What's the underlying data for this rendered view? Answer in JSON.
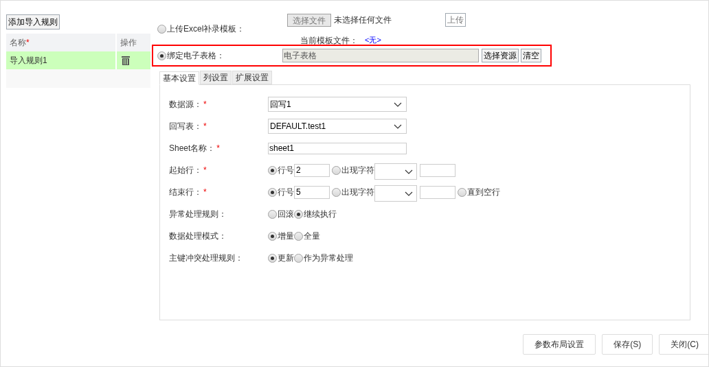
{
  "rules_panel": {
    "add_button": "添加导入规则",
    "columns": [
      {
        "label": "名称",
        "required_mark": "*"
      },
      {
        "label": "操作"
      }
    ],
    "rows": [
      {
        "name": "导入规则1",
        "selected": true
      }
    ]
  },
  "upload": {
    "label": "上传Excel补录模板：",
    "selected": false,
    "file_button": "选择文件",
    "file_status": "未选择任何文件",
    "upload_button": "上传",
    "current_label": "当前模板文件：",
    "current_value": "<无>"
  },
  "bind": {
    "label": "绑定电子表格：",
    "selected": true,
    "highlighted": true,
    "value": "电子表格",
    "choose_button": "选择资源",
    "clear_button": "清空"
  },
  "tabs": [
    {
      "label": "基本设置",
      "selected": true
    },
    {
      "label": "列设置",
      "selected": false
    },
    {
      "label": "扩展设置",
      "selected": false
    }
  ],
  "fields": [
    {
      "label": "数据源：",
      "required_mark": "*",
      "kind": "select",
      "value": "回写1"
    },
    {
      "label": "回写表：",
      "required_mark": "*",
      "kind": "select",
      "value": "DEFAULT.test1"
    },
    {
      "label": "Sheet名称：",
      "required_mark": "*",
      "kind": "text",
      "value": "sheet1"
    },
    {
      "label": "起始行：",
      "required_mark": "*",
      "kind": "options",
      "items": [
        {
          "kind": "radio",
          "label": "行号",
          "selected": true
        },
        {
          "kind": "input",
          "value": "2"
        },
        {
          "kind": "radio",
          "label": "出现字符",
          "selected": false
        },
        {
          "kind": "select"
        },
        {
          "kind": "input"
        }
      ]
    },
    {
      "label": "结束行：",
      "required_mark": "*",
      "kind": "options",
      "items": [
        {
          "kind": "radio",
          "label": "行号",
          "selected": true
        },
        {
          "kind": "input",
          "value": "5"
        },
        {
          "kind": "radio",
          "label": "出现字符",
          "selected": false
        },
        {
          "kind": "select"
        },
        {
          "kind": "input"
        },
        {
          "kind": "radio",
          "label": "直到空行",
          "selected": false
        }
      ]
    },
    {
      "label": "异常处理规则：",
      "kind": "options",
      "items": [
        {
          "kind": "radio",
          "label": "回滚",
          "selected": false
        },
        {
          "kind": "radio",
          "label": "继续执行",
          "selected": true
        }
      ]
    },
    {
      "label": "数据处理模式：",
      "kind": "options",
      "items": [
        {
          "kind": "radio",
          "label": "增量",
          "selected": true
        },
        {
          "kind": "radio",
          "label": "全量",
          "selected": false
        }
      ]
    },
    {
      "label": "主键冲突处理规则：",
      "kind": "options",
      "items": [
        {
          "kind": "radio",
          "label": "更新",
          "selected": true
        },
        {
          "kind": "radio",
          "label": "作为异常处理",
          "selected": false
        }
      ]
    }
  ],
  "footer_buttons": [
    "参数布局设置",
    "保存(S)",
    "关闭(C)"
  ]
}
